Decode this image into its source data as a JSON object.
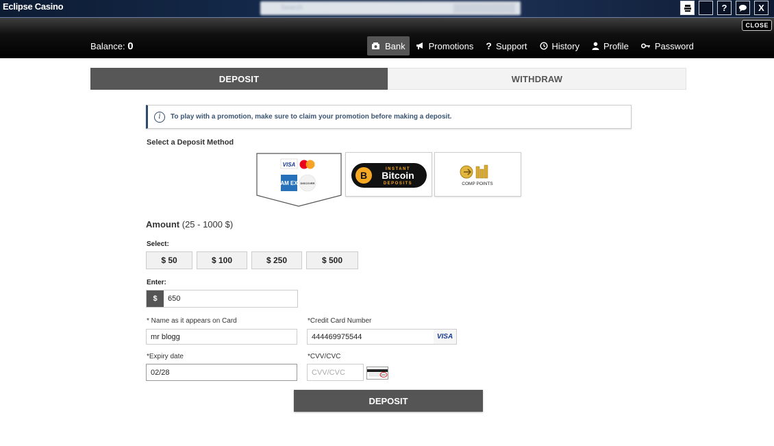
{
  "app": {
    "brand": "Eclipse Casino"
  },
  "topbar": {
    "search_placeholder": "Search",
    "search_button": "Filters",
    "icons": [
      "cashier-icon",
      "blank-icon",
      "help-icon",
      "chat-icon",
      "close-icon"
    ],
    "help_label": "?",
    "close_label": "X"
  },
  "header": {
    "close_label": "CLOSE",
    "balance_label": "Balance:",
    "balance_value": "0",
    "nav": [
      {
        "label": "Bank",
        "icon": "bank-icon",
        "active": true
      },
      {
        "label": "Promotions",
        "icon": "megaphone-icon"
      },
      {
        "label": "Support",
        "icon": "question-icon"
      },
      {
        "label": "History",
        "icon": "clock-icon"
      },
      {
        "label": "Profile",
        "icon": "user-icon"
      },
      {
        "label": "Password",
        "icon": "key-icon"
      }
    ]
  },
  "tabs": [
    {
      "label": "DEPOSIT",
      "active": true
    },
    {
      "label": "WITHDRAW",
      "active": false
    }
  ],
  "notice": {
    "text": "To play with a promotion, make sure to claim your promotion before making a deposit."
  },
  "methods": {
    "title": "Select a Deposit Method",
    "options": [
      {
        "name": "cards",
        "labels": [
          "VISA",
          "AM EX",
          "DISCOVER"
        ],
        "selected": true
      },
      {
        "name": "bitcoin",
        "labels": [
          "INSTANT",
          "Bitcoin",
          "DEPOSITS"
        ]
      },
      {
        "name": "comp-points",
        "labels": [
          "COMP POINTS"
        ]
      }
    ]
  },
  "amount": {
    "label": "Amount",
    "range": "(25 - 1000 $)",
    "select_label": "Select:",
    "quick": [
      "$ 50",
      "$ 100",
      "$ 250",
      "$ 500"
    ],
    "enter_label": "Enter:",
    "currency": "$",
    "value": "650"
  },
  "form": {
    "name_label": "* Name as it appears on Card",
    "name_value": "mr blogg",
    "card_label": "*Credit Card Number",
    "card_value": "444469975544",
    "card_brand": "VISA",
    "expiry_label": "*Expiry date",
    "expiry_value": "02/28",
    "cvv_label": "*CVV/CVC",
    "cvv_placeholder": "CVV/CVC",
    "cvv_hint": "000"
  },
  "submit": {
    "label": "DEPOSIT"
  },
  "colors": {
    "tab_active": "#575757",
    "header_bg": "#000000",
    "topbar": "#14294a",
    "notice_accent": "#2d4a6b",
    "visa_blue": "#1a3a8f",
    "bitcoin_orange": "#f7a823"
  }
}
